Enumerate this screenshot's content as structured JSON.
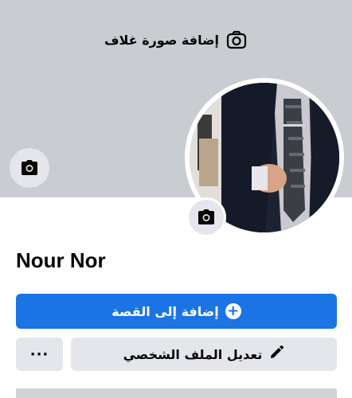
{
  "cover": {
    "add_cover_label": "إضافة صورة غلاف",
    "background_color": "#c9ccd1",
    "camera_icon": "camera-icon"
  },
  "profile": {
    "name": "Nour Nor",
    "avatar_icon": "camera-icon"
  },
  "actions": {
    "add_to_story_label": "إضافة إلى القصة",
    "add_to_story_icon": "plus-circle-icon",
    "edit_profile_label": "تعديل الملف الشخصي",
    "edit_profile_icon": "pencil-icon",
    "more_label": "···",
    "primary_color": "#1b74e4",
    "secondary_color": "#e4e6eb"
  }
}
